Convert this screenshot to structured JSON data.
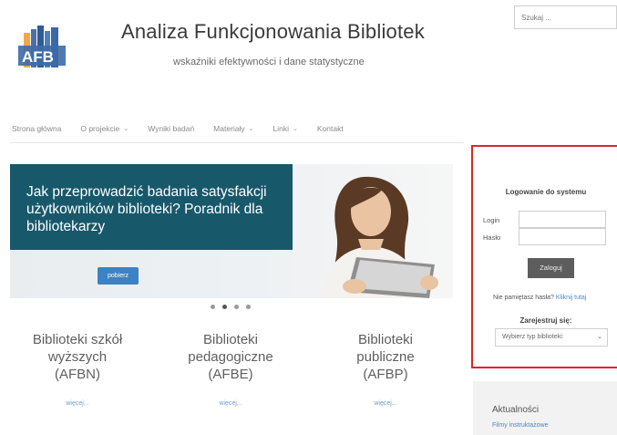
{
  "site": {
    "logo_text": "AFB",
    "title": "Analiza Funkcjonowania Bibliotek",
    "subtitle": "wskaźniki efektywności i dane statystyczne"
  },
  "search": {
    "placeholder": "Szukaj ..."
  },
  "nav": {
    "items": [
      {
        "label": "Strona główna",
        "has_dropdown": false
      },
      {
        "label": "O projekcie",
        "has_dropdown": true
      },
      {
        "label": "Wyniki badań",
        "has_dropdown": false
      },
      {
        "label": "Materiały",
        "has_dropdown": true
      },
      {
        "label": "Linki",
        "has_dropdown": true
      },
      {
        "label": "Kontakt",
        "has_dropdown": false
      }
    ],
    "chevron": "⌄"
  },
  "slider": {
    "headline": "Jak przeprowadzić badania satysfakcji użytkowników biblioteki? Poradnik dla bibliotekarzy",
    "button_label": "pobierz",
    "slide_count": 4,
    "active_slide": 2,
    "banner_color": "#18586b",
    "button_color": "#3b83c4"
  },
  "categories": [
    {
      "line1": "Biblioteki szkół",
      "line2": "wyższych",
      "line3": "(AFBN)",
      "more": "więcej..."
    },
    {
      "line1": "Biblioteki",
      "line2": "pedagogiczne",
      "line3": "(AFBE)",
      "more": "więcej..."
    },
    {
      "line1": "Biblioteki",
      "line2": "publiczne",
      "line3": "(AFBP)",
      "more": "więcej..."
    }
  ],
  "login": {
    "title": "Logowanie do systemu",
    "login_label": "Login",
    "password_label": "Hasło",
    "submit_label": "Zaloguj",
    "forgot_text": "Nie pamiętasz hasła?",
    "forgot_link": "Kliknij tutaj",
    "register_title": "Zarejestruj się:",
    "select_value": "Wybierz typ biblioteki:",
    "highlight_color": "#d9262c"
  },
  "news": {
    "title": "Aktualności",
    "link": "Filmy instruktażowe"
  }
}
